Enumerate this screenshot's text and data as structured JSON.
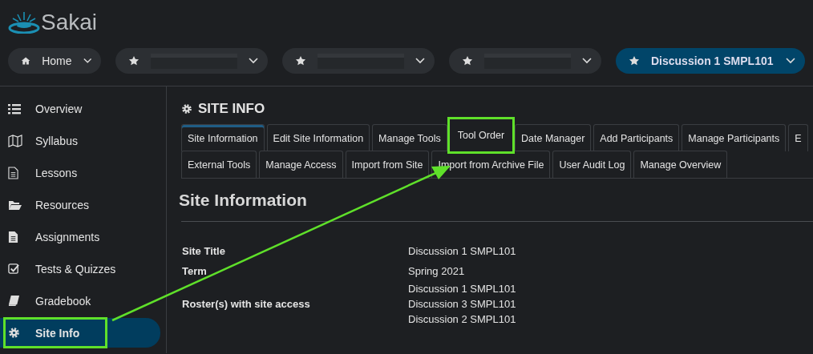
{
  "logo": {
    "text": "Sakai"
  },
  "site_nav": [
    {
      "kind": "home",
      "label": "Home",
      "selected": false
    },
    {
      "kind": "favorite",
      "selected": false
    },
    {
      "kind": "favorite",
      "selected": false
    },
    {
      "kind": "favorite",
      "selected": false
    },
    {
      "kind": "favorite",
      "label": "Discussion 1 SMPL101",
      "selected": true
    }
  ],
  "sidebar": {
    "items": [
      {
        "kind": "overview",
        "label": "Overview",
        "selected": false,
        "highlighted": false
      },
      {
        "kind": "syllabus",
        "label": "Syllabus",
        "selected": false,
        "highlighted": false
      },
      {
        "kind": "lessons",
        "label": "Lessons",
        "selected": false,
        "highlighted": false
      },
      {
        "kind": "resources",
        "label": "Resources",
        "selected": false,
        "highlighted": false
      },
      {
        "kind": "assignments",
        "label": "Assignments",
        "selected": false,
        "highlighted": false
      },
      {
        "kind": "tests",
        "label": "Tests & Quizzes",
        "selected": false,
        "highlighted": false
      },
      {
        "kind": "gradebook",
        "label": "Gradebook",
        "selected": false,
        "highlighted": false
      },
      {
        "kind": "siteinfo",
        "label": "Site Info",
        "selected": true,
        "highlighted": true
      }
    ]
  },
  "tool": {
    "title": "SITE INFO",
    "tab_rows": [
      [
        {
          "label": "Site Information",
          "selected": true,
          "highlighted": false
        },
        {
          "label": "Edit Site Information",
          "selected": false,
          "highlighted": false
        },
        {
          "label": "Manage Tools",
          "selected": false,
          "highlighted": false
        },
        {
          "label": "Tool Order",
          "selected": false,
          "highlighted": true
        },
        {
          "label": "Date Manager",
          "selected": false,
          "highlighted": false
        },
        {
          "label": "Add Participants",
          "selected": false,
          "highlighted": false
        },
        {
          "label": "Manage Participants",
          "selected": false,
          "highlighted": false
        },
        {
          "label": "E",
          "selected": false,
          "highlighted": false
        }
      ],
      [
        {
          "label": "External Tools",
          "selected": false,
          "highlighted": false
        },
        {
          "label": "Manage Access",
          "selected": false,
          "highlighted": false
        },
        {
          "label": "Import from Site",
          "selected": false,
          "highlighted": false
        },
        {
          "label": "Import from Archive File",
          "selected": false,
          "highlighted": false
        },
        {
          "label": "User Audit Log",
          "selected": false,
          "highlighted": false
        },
        {
          "label": "Manage Overview",
          "selected": false,
          "highlighted": false
        }
      ]
    ],
    "section_title": "Site Information",
    "fields": [
      {
        "label": "Site Title",
        "values": [
          "Discussion 1 SMPL101"
        ]
      },
      {
        "label": "Term",
        "values": [
          "Spring 2021"
        ]
      },
      {
        "label": "Roster(s) with site access",
        "values": [
          "Discussion 1 SMPL101",
          "Discussion 3 SMPL101",
          "Discussion 2 SMPL101"
        ]
      }
    ]
  }
}
